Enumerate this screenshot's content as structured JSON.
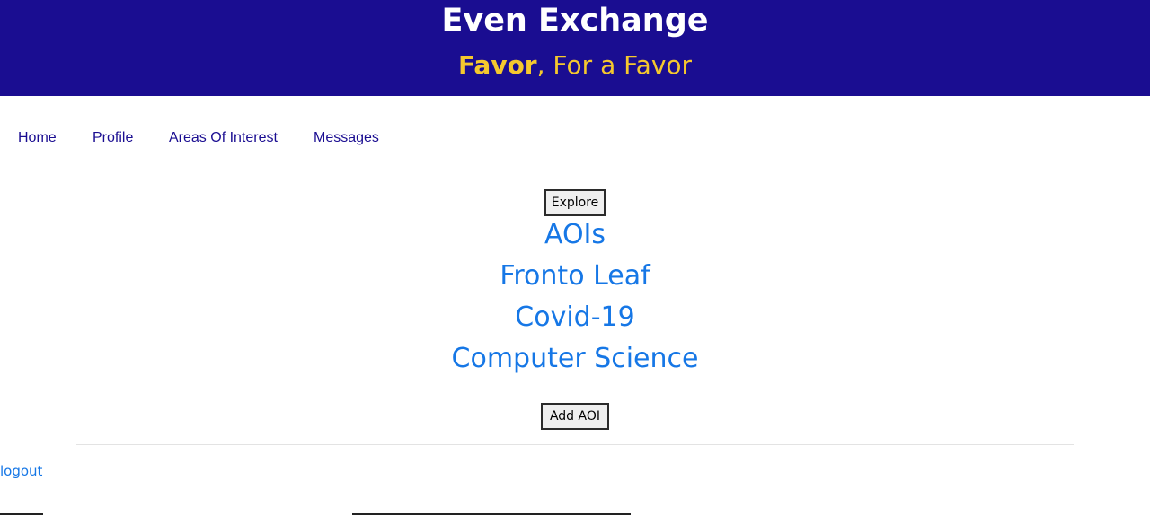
{
  "header": {
    "title": "Even Exchange",
    "tagline_strong": "Favor",
    "tagline_rest": ", For a Favor"
  },
  "nav": {
    "items": [
      "Home",
      "Profile",
      "Areas Of Interest",
      "Messages"
    ]
  },
  "main": {
    "explore_label": "Explore",
    "aoi_heading": "AOIs",
    "aois": [
      "Fronto Leaf",
      "Covid-19",
      "Computer Science"
    ],
    "add_label": "Add AOI"
  },
  "footer": {
    "logout_label": "logout"
  },
  "colors": {
    "header_bg": "#1a0d91",
    "tagline": "#f5c82e",
    "nav_link": "#1a0d91",
    "link": "#1677e6"
  }
}
